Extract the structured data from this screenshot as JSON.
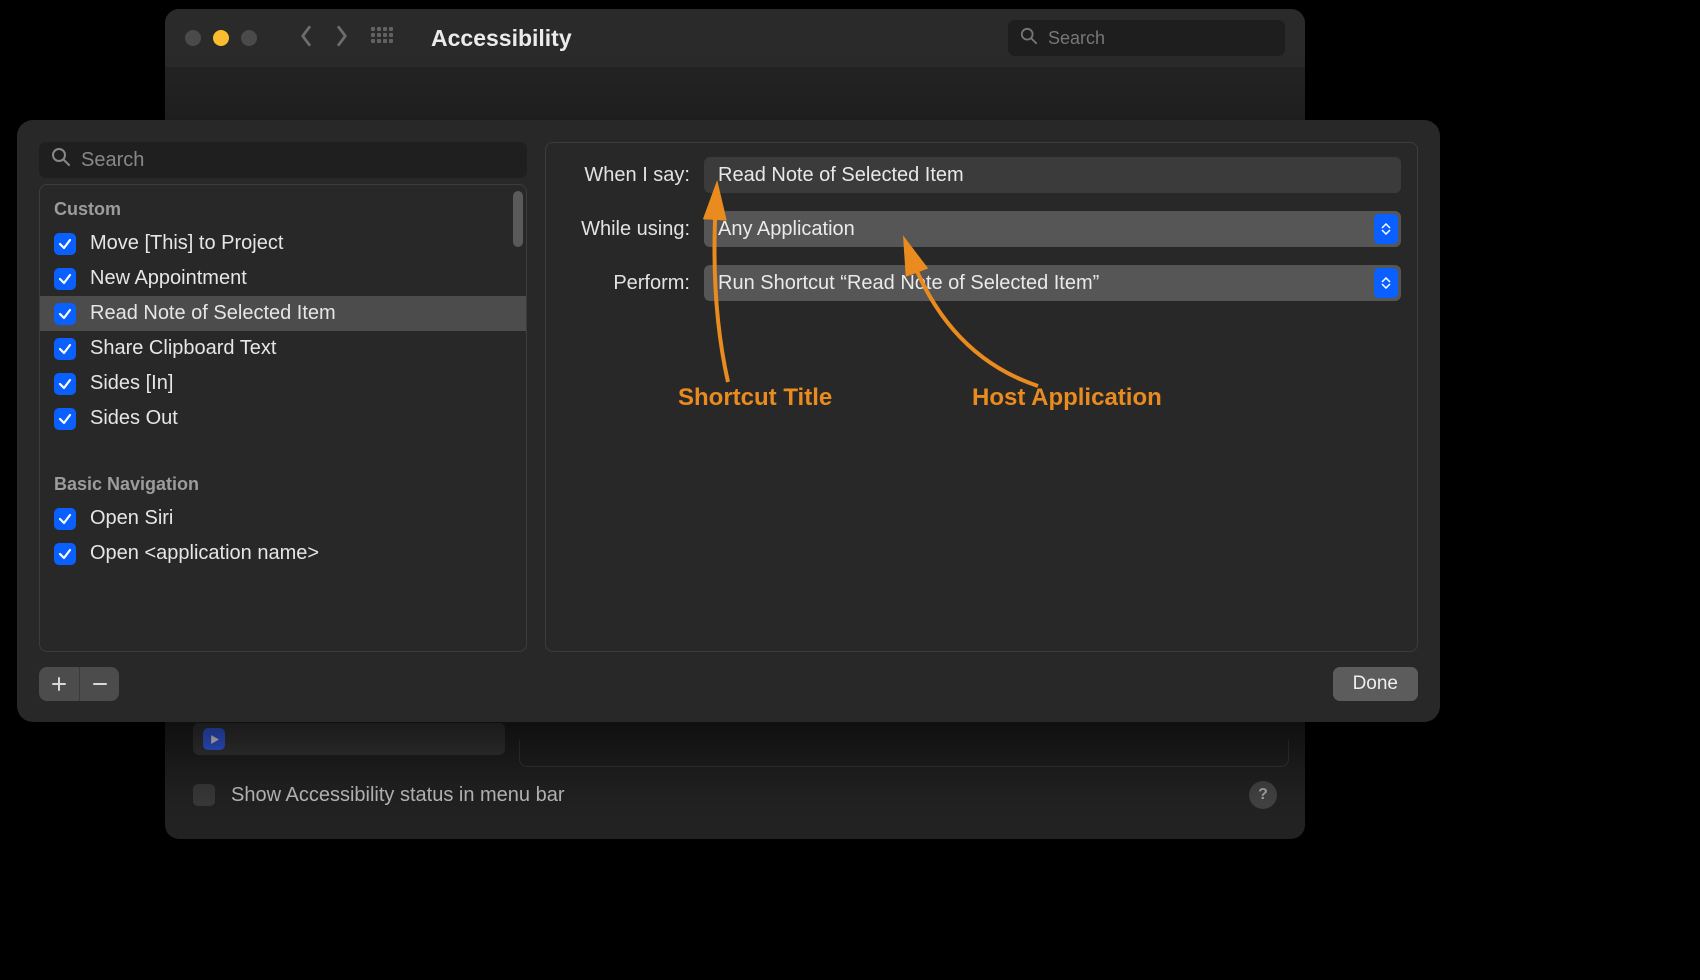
{
  "bg_window": {
    "title": "Accessibility",
    "search_placeholder": "Search",
    "status_checkbox_label": "Show Accessibility status in menu bar"
  },
  "sheet": {
    "search_placeholder": "Search",
    "sections": [
      {
        "title": "Custom",
        "items": [
          {
            "label": "Move [This] to Project",
            "checked": true,
            "selected": false
          },
          {
            "label": "New Appointment",
            "checked": true,
            "selected": false
          },
          {
            "label": "Read Note of Selected Item",
            "checked": true,
            "selected": true
          },
          {
            "label": "Share Clipboard Text",
            "checked": true,
            "selected": false
          },
          {
            "label": "Sides [In]",
            "checked": true,
            "selected": false
          },
          {
            "label": "Sides Out",
            "checked": true,
            "selected": false
          }
        ]
      },
      {
        "title": "Basic Navigation",
        "items": [
          {
            "label": "Open Siri",
            "checked": true,
            "selected": false
          },
          {
            "label": "Open <application name>",
            "checked": true,
            "selected": false
          }
        ]
      }
    ],
    "form": {
      "when_i_say_label": "When I say:",
      "when_i_say_value": "Read Note of Selected Item",
      "while_using_label": "While using:",
      "while_using_value": "Any Application",
      "perform_label": "Perform:",
      "perform_value": "Run Shortcut “Read Note of Selected Item”"
    },
    "done_label": "Done"
  },
  "annotations": {
    "shortcut_title": "Shortcut Title",
    "host_application": "Host Application"
  }
}
